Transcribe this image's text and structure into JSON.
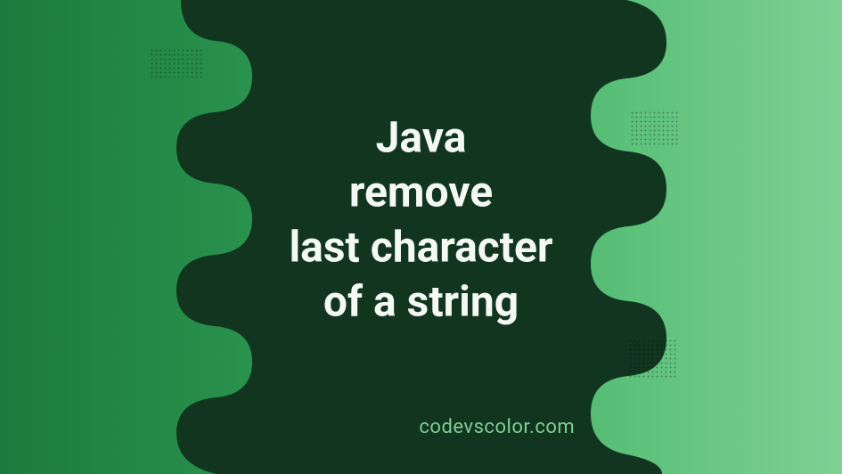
{
  "title": {
    "line1": "Java",
    "line2": "remove",
    "line3": "last character",
    "line4": "of a string"
  },
  "watermark": "codevscolor.com",
  "colors": {
    "gradient_start": "#1e7a3e",
    "gradient_end": "#7fd094",
    "blob": "#11351f",
    "text": "#f5f9f4",
    "watermark": "#7fd094"
  }
}
